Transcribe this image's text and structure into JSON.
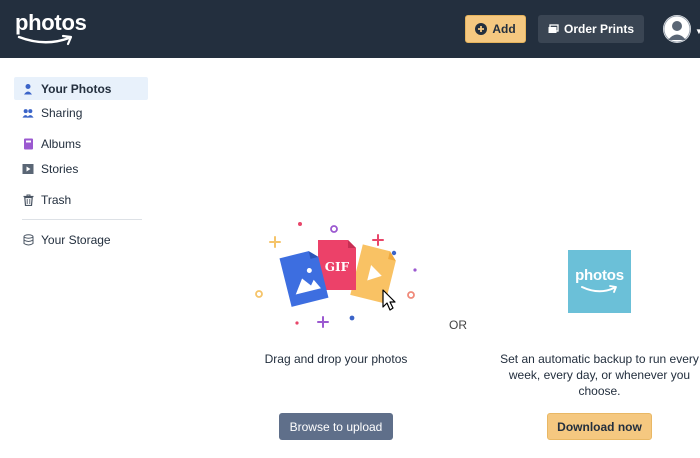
{
  "header": {
    "logo_text": "photos",
    "add_label": "Add",
    "order_prints_label": "Order Prints"
  },
  "sidebar": {
    "items": [
      {
        "label": "Your Photos",
        "icon": "person-icon",
        "active": true
      },
      {
        "label": "Sharing",
        "icon": "people-icon"
      },
      {
        "label": "Albums",
        "icon": "album-icon"
      },
      {
        "label": "Stories",
        "icon": "stories-icon"
      },
      {
        "label": "Trash",
        "icon": "trash-icon"
      },
      {
        "label": "Your Storage",
        "icon": "storage-icon"
      }
    ]
  },
  "main": {
    "upload": {
      "illustration_label": "GIF",
      "instruction": "Drag and drop your photos",
      "browse_label": "Browse to upload"
    },
    "or_label": "OR",
    "app": {
      "tile_text": "photos",
      "description": "Set an automatic backup to run every week, every day, or whenever you choose.",
      "download_label": "Download now"
    }
  },
  "colors": {
    "header_bg": "#232f3e",
    "accent_yellow": "#f5c880",
    "active_nav_bg": "#e8f1fb",
    "browse_button": "#5f6f8a",
    "app_tile": "#6bc0d8"
  }
}
